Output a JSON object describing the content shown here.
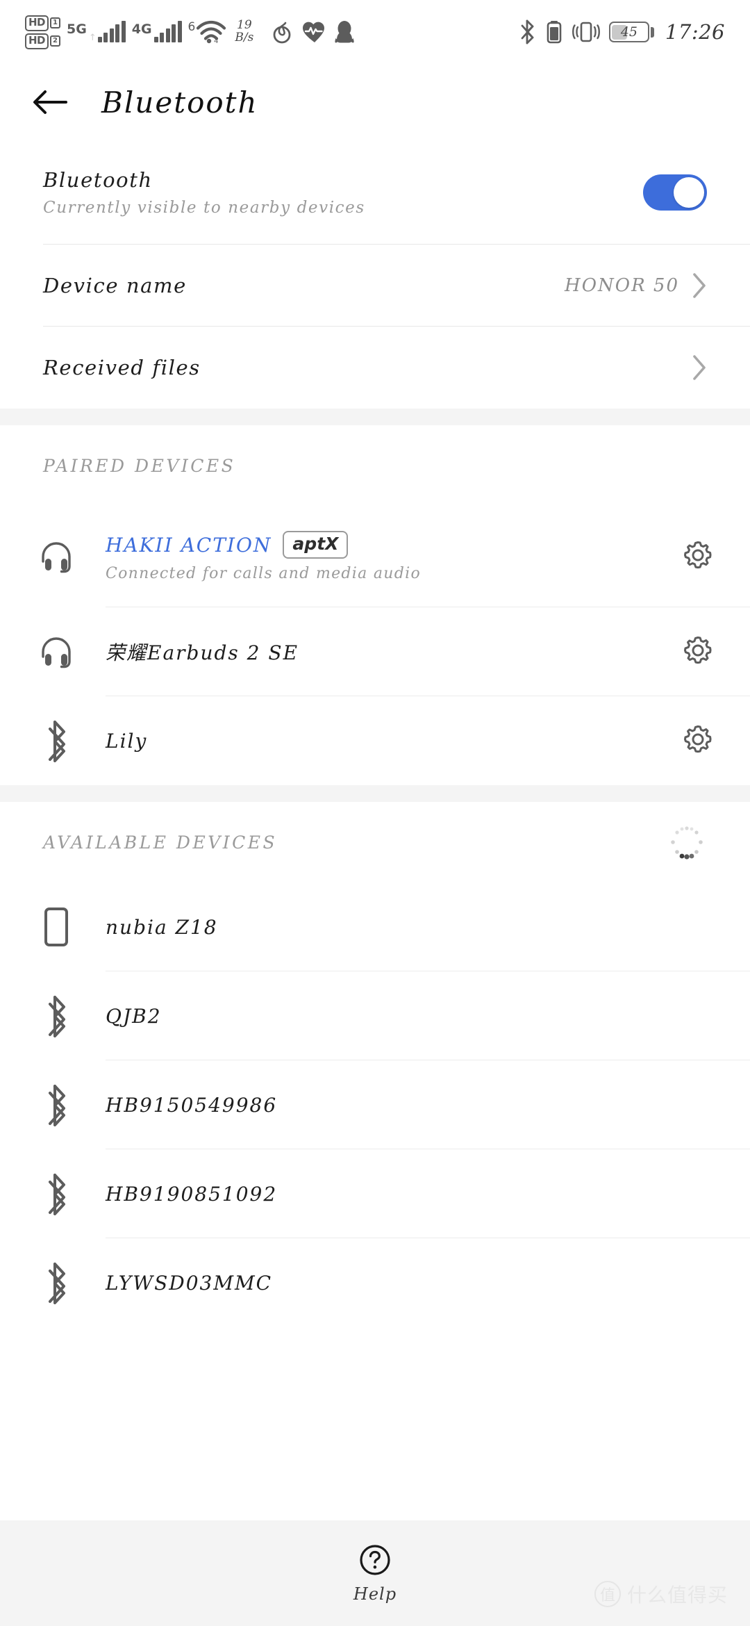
{
  "status_bar": {
    "hd_badges": [
      {
        "label": "HD",
        "sim": "1"
      },
      {
        "label": "HD",
        "sim": "2"
      }
    ],
    "network_1": {
      "generation": "5G",
      "bars": 5,
      "active_bars": 4,
      "up_arrow": "↑"
    },
    "network_2": {
      "generation": "4G",
      "bars": 5,
      "active_bars": 4
    },
    "wifi": {
      "generation": "6",
      "arrow": "4"
    },
    "net_speed": {
      "value": "19",
      "unit": "B/s"
    },
    "app_icons": [
      "netease-music-icon",
      "heart-rate-icon",
      "qq-penguin-icon"
    ],
    "right_icons": [
      "bluetooth-icon",
      "bluetooth-device-battery-icon",
      "vibrate-icon"
    ],
    "battery": {
      "percent": "45",
      "level": 45
    },
    "time": "17:26"
  },
  "header": {
    "back_icon": "back-arrow-icon",
    "title": "Bluetooth"
  },
  "bluetooth_switch": {
    "title": "Bluetooth",
    "subtitle": "Currently visible to nearby devices",
    "enabled": true,
    "accent_color": "#3d6ddb"
  },
  "settings_rows": [
    {
      "title": "Device name",
      "value": "HONOR 50",
      "chevron": "chevron-right-icon"
    },
    {
      "title": "Received files",
      "value": "",
      "chevron": "chevron-right-icon"
    }
  ],
  "paired_section": {
    "heading": "PAIRED DEVICES",
    "devices": [
      {
        "name": "HAKII ACTION",
        "name_color": "#3d6ddb",
        "codec_badge": "aptX",
        "subtitle": "Connected for calls and media audio",
        "icon": "headphones-icon",
        "settings_icon": "gear-icon",
        "connected": true
      },
      {
        "name": "荣耀Earbuds 2 SE",
        "name_color": "#1d1d1d",
        "codec_badge": "",
        "subtitle": "",
        "icon": "headphones-icon",
        "settings_icon": "gear-icon",
        "connected": false
      },
      {
        "name": "Lily",
        "name_color": "#1d1d1d",
        "codec_badge": "",
        "subtitle": "",
        "icon": "bluetooth-icon",
        "settings_icon": "gear-icon",
        "connected": false
      }
    ]
  },
  "available_section": {
    "heading": "AVAILABLE DEVICES",
    "scanning": true,
    "spinner_icon": "scanning-spinner-icon",
    "devices": [
      {
        "name": "nubia Z18",
        "icon": "phone-icon"
      },
      {
        "name": "QJB2",
        "icon": "bluetooth-icon"
      },
      {
        "name": "HB9150549986",
        "icon": "bluetooth-icon"
      },
      {
        "name": "HB9190851092",
        "icon": "bluetooth-icon"
      },
      {
        "name": "LYWSD03MMC",
        "icon": "bluetooth-icon"
      }
    ]
  },
  "footer": {
    "help_icon": "question-circle-icon",
    "help_label": "Help"
  },
  "watermark": {
    "mark": "值",
    "text": "什么值得买"
  }
}
